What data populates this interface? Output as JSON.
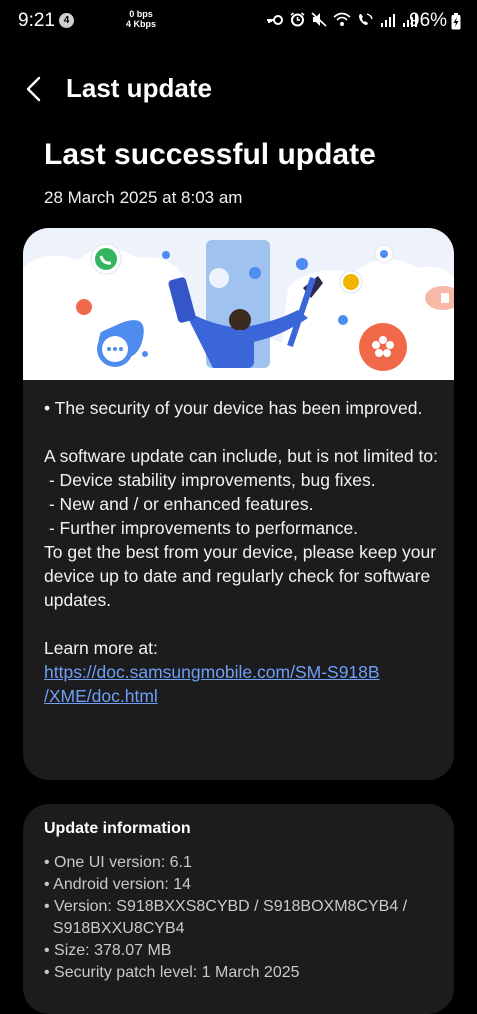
{
  "status_bar": {
    "time": "9:21",
    "notification_count": "4",
    "net_speed_up": "0 bps",
    "net_speed_down": "4 Kbps",
    "battery": "96%"
  },
  "header": {
    "title": "Last update"
  },
  "page": {
    "title": "Last successful update",
    "date": "28 March 2025 at 8:03 am"
  },
  "notes": {
    "security": "• The security of your device has been improved.",
    "intro": "A software update can include, but is not limited to:",
    "items": [
      " - Device stability improvements, bug fixes.",
      " - New and / or enhanced features.",
      " - Further improvements to performance."
    ],
    "advice": "To get the best from your device, please keep your device up to date and regularly check for software updates.",
    "learn_more": "Learn more at:",
    "link_line1": "https://doc.samsungmobile.com/SM-S918B",
    "link_line2": "/XME/doc.html"
  },
  "update_info": {
    "title": "Update information",
    "items": [
      "• One UI version: 6.1",
      "• Android version: 14",
      "• Version: S918BXXS8CYBD / S918BOXM8CYB4 /",
      "  S918BXXU8CYB4",
      "• Size: 378.07 MB",
      "• Security patch level: 1 March 2025"
    ]
  }
}
